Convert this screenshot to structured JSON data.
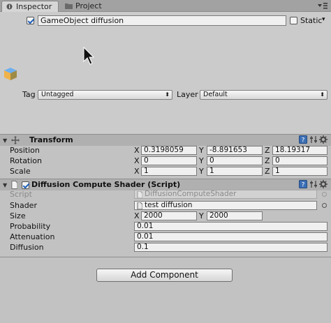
{
  "tabs": [
    {
      "label": "Inspector",
      "icon": "info-icon"
    },
    {
      "label": "Project",
      "icon": "folder-icon"
    }
  ],
  "gameobject": {
    "active": true,
    "name": "GameObject diffusion",
    "static_label": "Static",
    "static_checked": false,
    "tag_label": "Tag",
    "tag_value": "Untagged",
    "layer_label": "Layer",
    "layer_value": "Default"
  },
  "transform": {
    "title": "Transform",
    "rows": [
      {
        "label": "Position",
        "x": "0.3198059",
        "y": "-8.891653",
        "z": "18.19317"
      },
      {
        "label": "Rotation",
        "x": "0",
        "y": "0",
        "z": "0"
      },
      {
        "label": "Scale",
        "x": "1",
        "y": "1",
        "z": "1"
      }
    ],
    "axis": {
      "x": "X",
      "y": "Y",
      "z": "Z"
    }
  },
  "script_component": {
    "title": "Diffusion Compute Shader (Script)",
    "enabled": true,
    "script_label": "Script",
    "script_value": "DiffusionComputeShader",
    "shader_label": "Shader",
    "shader_value": "test diffusion",
    "size_label": "Size",
    "size_x": "2000",
    "size_y": "2000",
    "probability_label": "Probability",
    "probability_value": "0.01",
    "attenuation_label": "Attenuation",
    "attenuation_value": "0.01",
    "diffusion_label": "Diffusion",
    "diffusion_value": "0.1"
  },
  "add_component_label": "Add Component",
  "colors": {
    "panel": "#c2c2c2",
    "header": "#b0b0b0",
    "accent": "#1d5fb8"
  }
}
